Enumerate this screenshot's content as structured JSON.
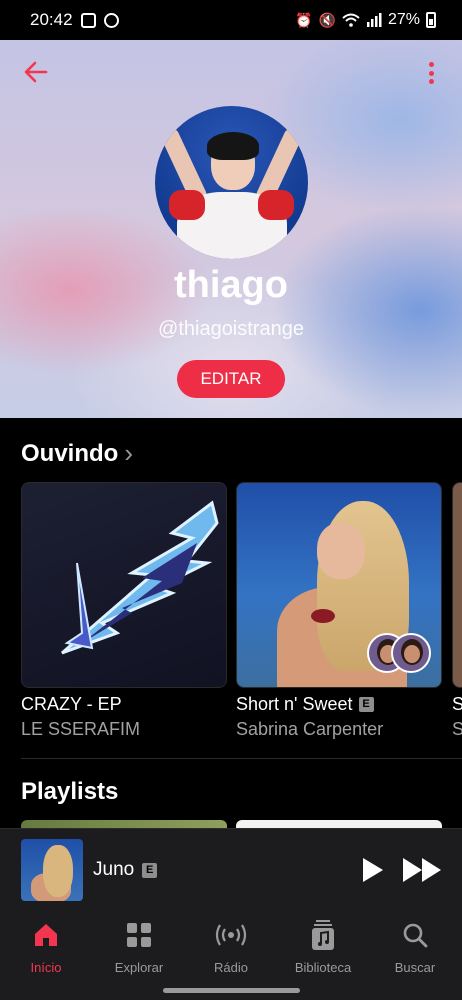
{
  "status_bar": {
    "time": "20:42",
    "battery": "27%"
  },
  "header": {
    "back_icon": "arrow-left-icon",
    "more_icon": "more-vertical-icon",
    "accent": "#f2364f"
  },
  "profile": {
    "name": "thiago",
    "handle": "@thiagoistrange",
    "edit_label": "EDITAR"
  },
  "listening": {
    "title": "Ouvindo",
    "items": [
      {
        "title": "CRAZY - EP",
        "artist": "LE SSERAFIM",
        "explicit": false
      },
      {
        "title": "Short n' Sweet",
        "artist": "Sabrina Carpenter",
        "explicit": true,
        "explicit_mark": "E"
      },
      {
        "title": "S",
        "artist": "S"
      }
    ]
  },
  "playlists": {
    "title": "Playlists"
  },
  "now_playing": {
    "title": "Juno",
    "explicit_mark": "E"
  },
  "tabs": [
    {
      "label": "Início",
      "icon": "home-icon",
      "active": true
    },
    {
      "label": "Explorar",
      "icon": "grid-icon",
      "active": false
    },
    {
      "label": "Rádio",
      "icon": "radio-icon",
      "active": false
    },
    {
      "label": "Biblioteca",
      "icon": "library-icon",
      "active": false
    },
    {
      "label": "Buscar",
      "icon": "search-icon",
      "active": false
    }
  ]
}
